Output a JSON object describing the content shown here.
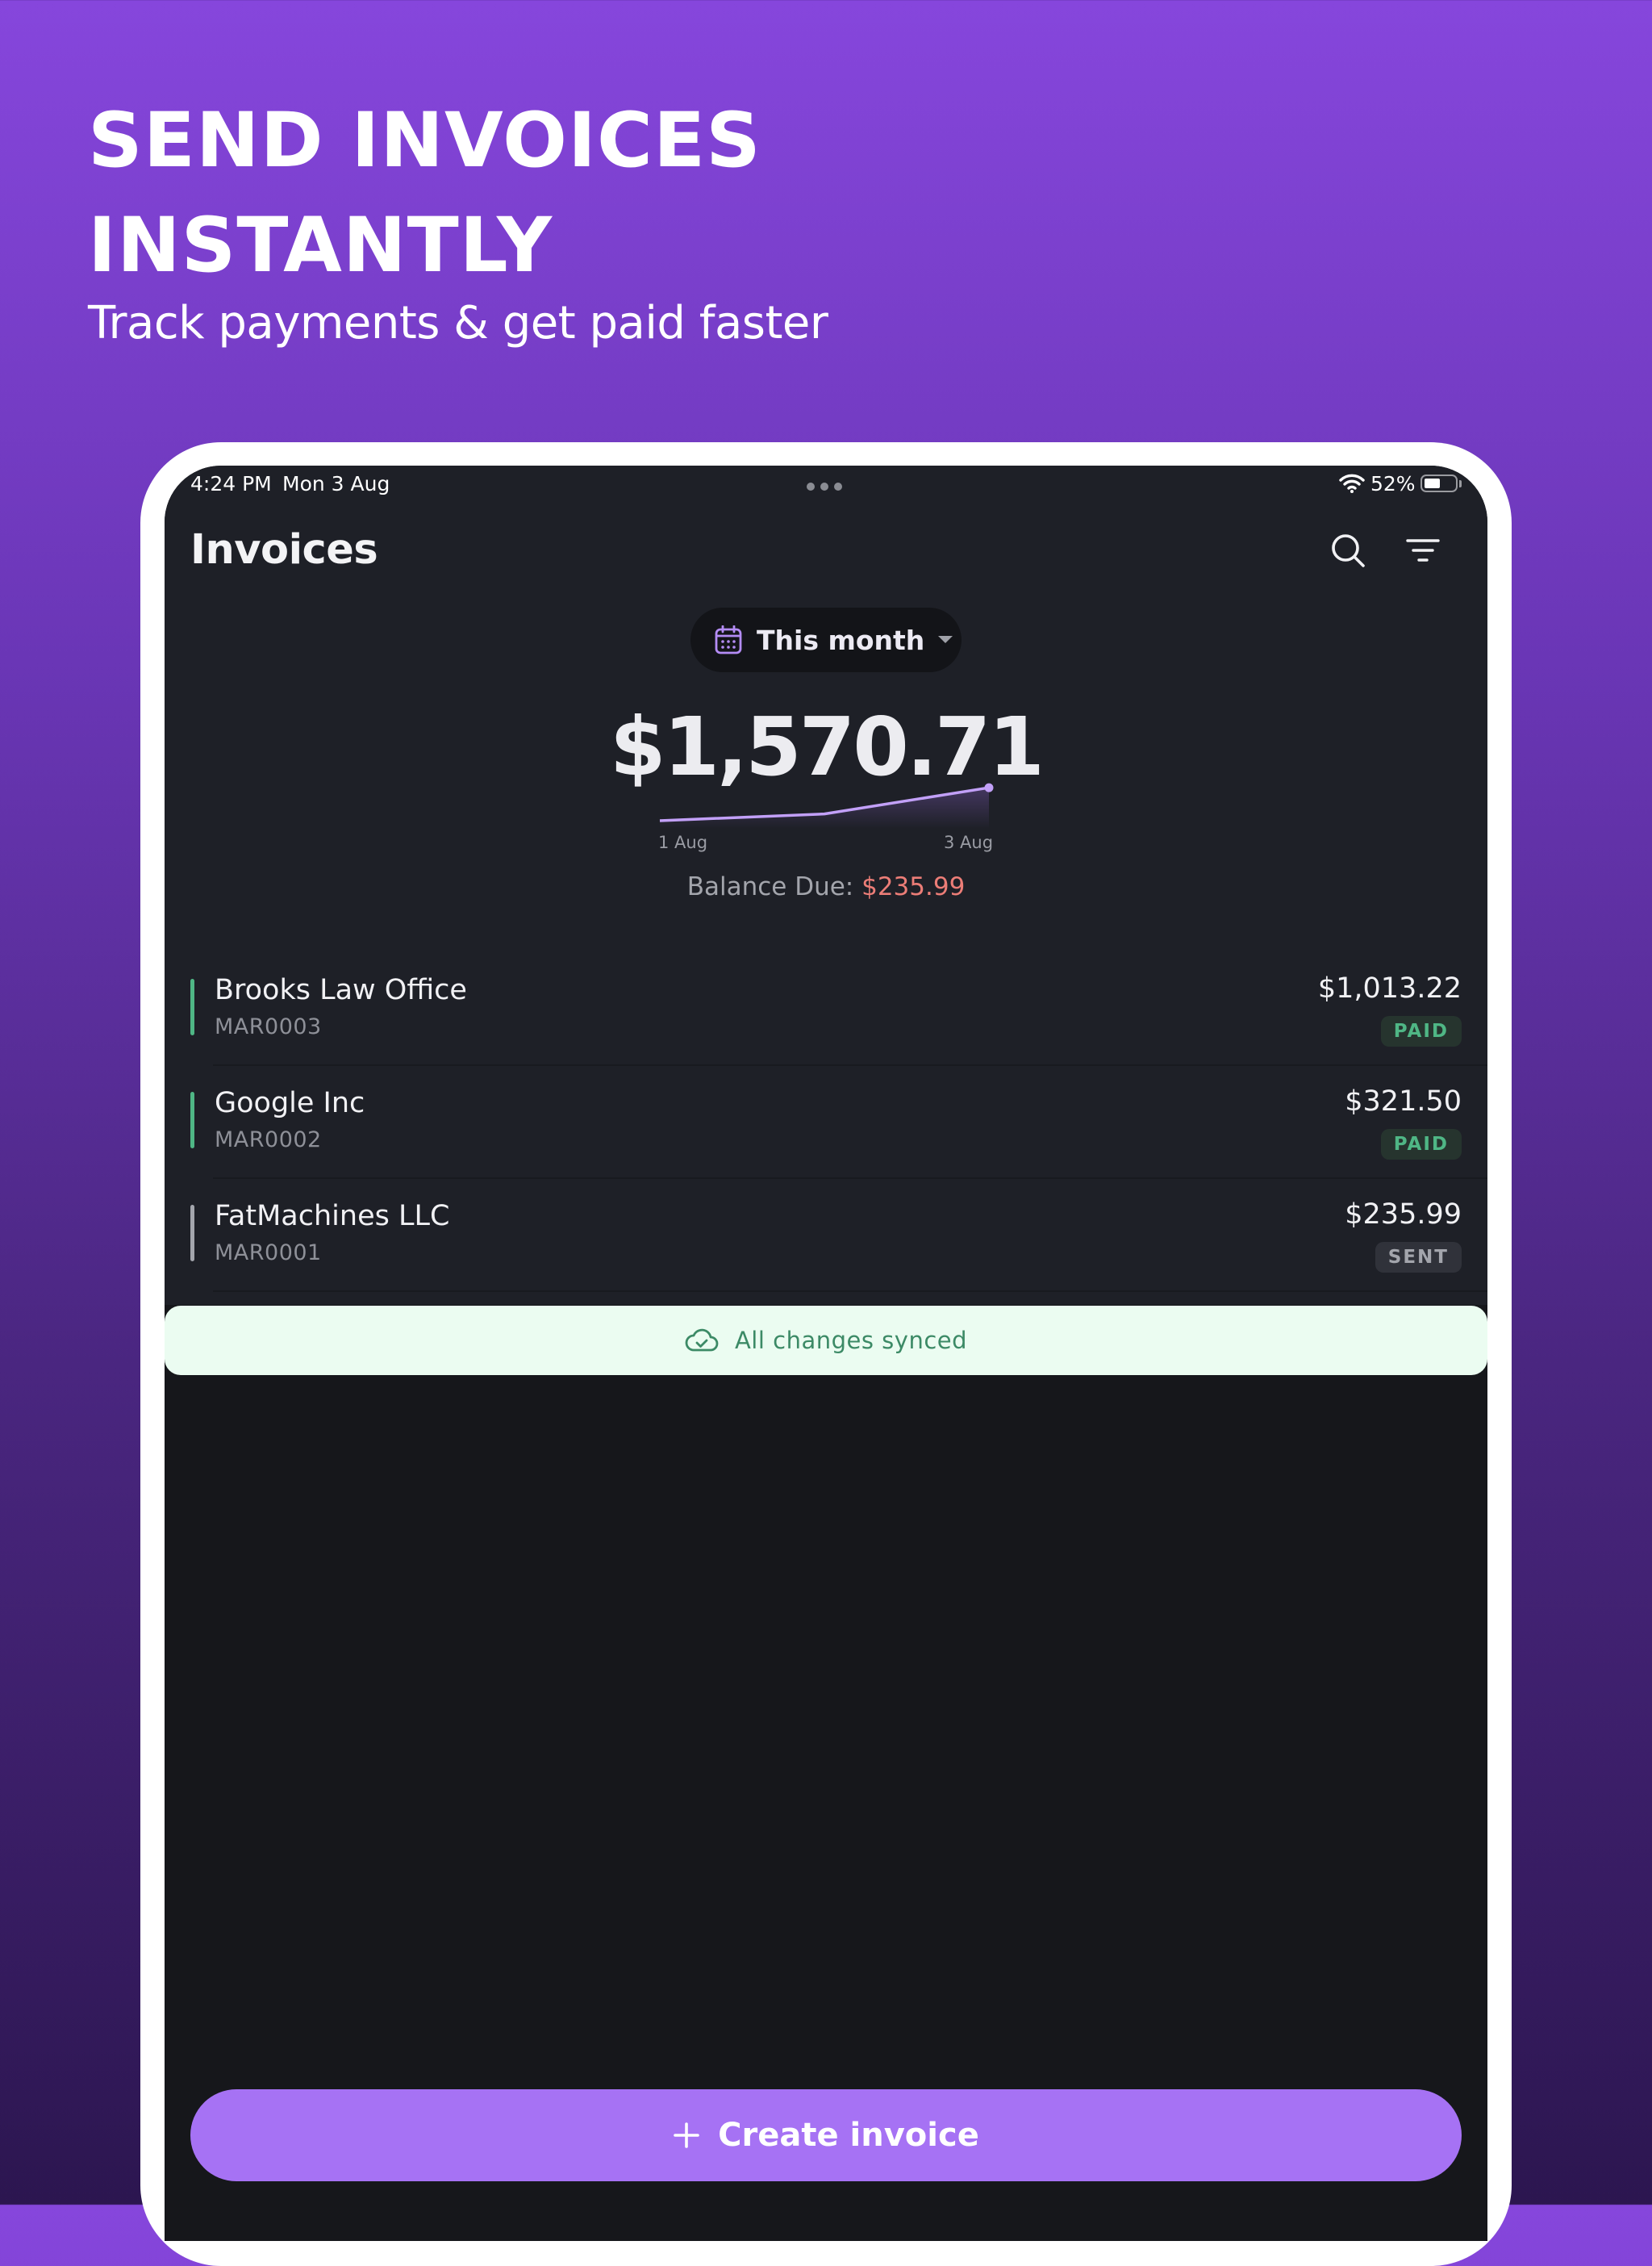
{
  "promo": {
    "headline_line1": "SEND INVOICES",
    "headline_line2": "INSTANTLY",
    "subheadline": "Track payments & get paid faster"
  },
  "status_bar": {
    "time": "4:24 PM",
    "date": "Mon 3 Aug",
    "battery": "52%",
    "battery_level": 0.52
  },
  "nav": {
    "title": "Invoices",
    "icons": [
      "search-icon",
      "filter-icon"
    ]
  },
  "period_selector": {
    "icon": "calendar-icon",
    "label": "This month",
    "caret": "caret-down-icon"
  },
  "summary": {
    "total": "$1,570.71",
    "balance_label": "Balance Due:",
    "balance_value": "$235.99"
  },
  "chart_data": {
    "type": "line",
    "x": [
      "1 Aug",
      "2 Aug",
      "3 Aug"
    ],
    "series": [
      {
        "values": [
          0,
          321.5,
          1570.71
        ]
      }
    ],
    "x_tick_labels": [
      "1 Aug",
      "3 Aug"
    ],
    "grid": false
  },
  "invoices": [
    {
      "client": "Brooks Law Office",
      "number": "MAR0003",
      "amount": "$1,013.22",
      "status": "PAID",
      "status_color": "#4fb685"
    },
    {
      "client": "Google Inc",
      "number": "MAR0002",
      "amount": "$321.50",
      "status": "PAID",
      "status_color": "#4fb685"
    },
    {
      "client": "FatMachines LLC",
      "number": "MAR0001",
      "amount": "$235.99",
      "status": "SENT",
      "status_color": "#a3a5ac"
    }
  ],
  "sync": {
    "icon": "cloud-check-icon",
    "text": "All changes synced"
  },
  "create_button": {
    "icon": "plus-icon",
    "label": "Create invoice"
  },
  "colors": {
    "accent": "#a672f4",
    "paid": "#4fb685",
    "balance_due": "#ec7d77",
    "background_top": "#8646dc",
    "background_bottom": "#2c1650"
  }
}
